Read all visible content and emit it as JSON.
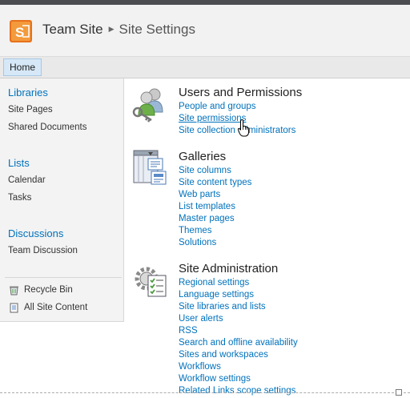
{
  "header": {
    "site_title": "Team Site",
    "current_page": "Site Settings"
  },
  "nav": {
    "home_tab": "Home"
  },
  "left_nav": {
    "libraries": {
      "heading": "Libraries",
      "items": [
        "Site Pages",
        "Shared Documents"
      ]
    },
    "lists": {
      "heading": "Lists",
      "items": [
        "Calendar",
        "Tasks"
      ]
    },
    "discussions": {
      "heading": "Discussions",
      "items": [
        "Team Discussion"
      ]
    },
    "footer": {
      "recycle_bin": "Recycle Bin",
      "all_site_content": "All Site Content"
    }
  },
  "sections": {
    "users": {
      "title": "Users and Permissions",
      "links": [
        "People and groups",
        "Site permissions",
        "Site collection administrators"
      ]
    },
    "galleries": {
      "title": "Galleries",
      "links": [
        "Site columns",
        "Site content types",
        "Web parts",
        "List templates",
        "Master pages",
        "Themes",
        "Solutions"
      ]
    },
    "admin": {
      "title": "Site Administration",
      "links": [
        "Regional settings",
        "Language settings",
        "Site libraries and lists",
        "User alerts",
        "RSS",
        "Search and offline availability",
        "Sites and workspaces",
        "Workflows",
        "Workflow settings",
        "Related Links scope settings"
      ]
    }
  },
  "icons": {
    "logo": "sharepoint-logo-icon",
    "users": "users-keys-icon",
    "galleries": "galleries-icon",
    "admin": "site-admin-gear-icon",
    "recycle": "recycle-bin-icon",
    "all_content": "all-site-content-icon",
    "cursor": "hand-pointer-cursor-icon"
  },
  "colors": {
    "link": "#0072bc",
    "logo": "#e8711b",
    "home_tab": "#d6e8f7"
  }
}
